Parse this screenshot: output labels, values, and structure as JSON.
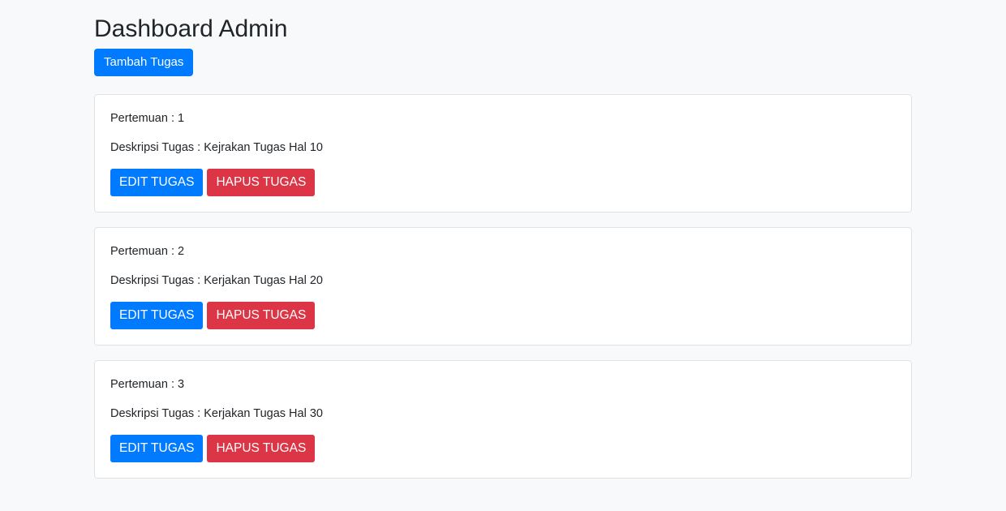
{
  "header": {
    "title": "Dashboard Admin",
    "add_button_label": "Tambah Tugas"
  },
  "tasks": [
    {
      "meeting_label": "Pertemuan : ",
      "meeting_value": "1",
      "desc_label": "Deskripsi Tugas : ",
      "desc_value": "Kejrakan Tugas Hal 10",
      "edit_label": "EDIT TUGAS",
      "delete_label": "HAPUS TUGAS"
    },
    {
      "meeting_label": "Pertemuan : ",
      "meeting_value": "2",
      "desc_label": "Deskripsi Tugas : ",
      "desc_value": "Kerjakan Tugas Hal 20",
      "edit_label": "EDIT TUGAS",
      "delete_label": "HAPUS TUGAS"
    },
    {
      "meeting_label": "Pertemuan : ",
      "meeting_value": "3",
      "desc_label": "Deskripsi Tugas : ",
      "desc_value": "Kerjakan Tugas Hal 30",
      "edit_label": "EDIT TUGAS",
      "delete_label": "HAPUS TUGAS"
    }
  ],
  "colors": {
    "primary": "#007bff",
    "danger": "#dc3545",
    "background": "#f8f9fa",
    "card": "#ffffff"
  }
}
